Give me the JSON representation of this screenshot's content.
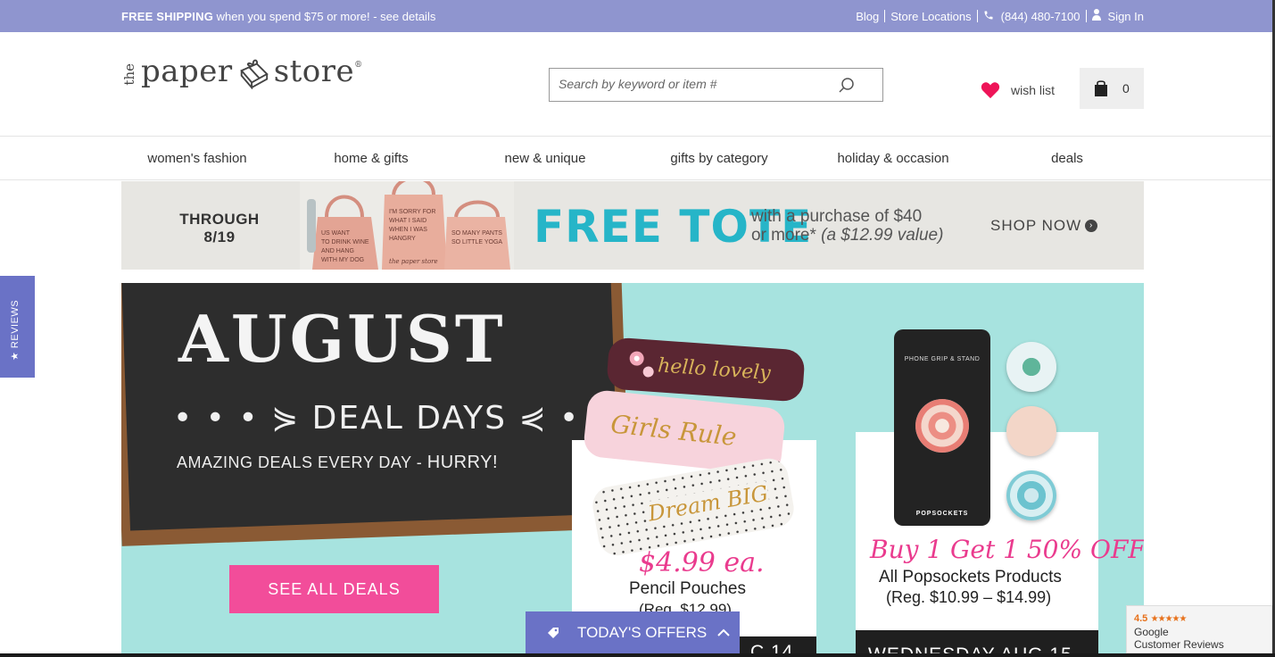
{
  "topbar": {
    "promo_bold": "FREE SHIPPING",
    "promo_rest": " when you spend $75 or more! - see details",
    "blog": "Blog",
    "store_locations": "Store Locations",
    "phone": "(844) 480-7100",
    "sign_in": "Sign In"
  },
  "logo": {
    "the": "the",
    "word1": "paper",
    "word2": "store",
    "reg": "®"
  },
  "search": {
    "placeholder": "Search by keyword or item #",
    "value": ""
  },
  "wishlist": {
    "label": "wish list"
  },
  "cart": {
    "count": "0"
  },
  "nav": {
    "items": [
      "women's fashion",
      "home & gifts",
      "new & unique",
      "gifts by category",
      "holiday & occasion",
      "deals"
    ]
  },
  "tote_banner": {
    "through_line1": "THROUGH",
    "through_line2": "8/19",
    "headline": "FREE TOTE",
    "terms_line1": "with a purchase of $40",
    "terms_line2a": "or more* ",
    "terms_line2b": "(a $12.99 value)",
    "shop_now": "SHOP NOW"
  },
  "hero": {
    "title": "AUGUST",
    "subtitle": "• • • ⋟ DEAL DAYS ⋞ • • •",
    "tagline": "AMAZING DEALS EVERY DAY - ",
    "tagline_end": "HURRY!",
    "cta": "SEE ALL DEALS",
    "pouches": [
      "hello lovely",
      "Girls Rule",
      "Dream BIG"
    ],
    "offer1": {
      "price": "$4.99 ea.",
      "name": "Pencil Pouches",
      "reg": "(Reg. $12.99)",
      "date": "C 14"
    },
    "phone_label": "PHONE GRIP & STAND",
    "phone_brand": "POPSOCKETS",
    "offer2": {
      "price": "Buy 1 Get 1 50% OFF",
      "name": "All Popsockets Products",
      "reg": "(Reg. $10.99 – $14.99)",
      "date": "WEDNESDAY AUG 15"
    }
  },
  "reviews_tab": {
    "label": "★ REVIEWS"
  },
  "offers_bar": {
    "label": "TODAY'S OFFERS"
  },
  "google_badge": {
    "rating": "4.5",
    "stars": "★★★★★",
    "line1": "Google",
    "line2": "Customer Reviews"
  },
  "colors": {
    "topbar": "#8f95cf",
    "tote_teal": "#26b5c8",
    "hero_bg": "#a7e3df",
    "pink": "#f24d9a",
    "offers_purple": "#6a72c6"
  }
}
